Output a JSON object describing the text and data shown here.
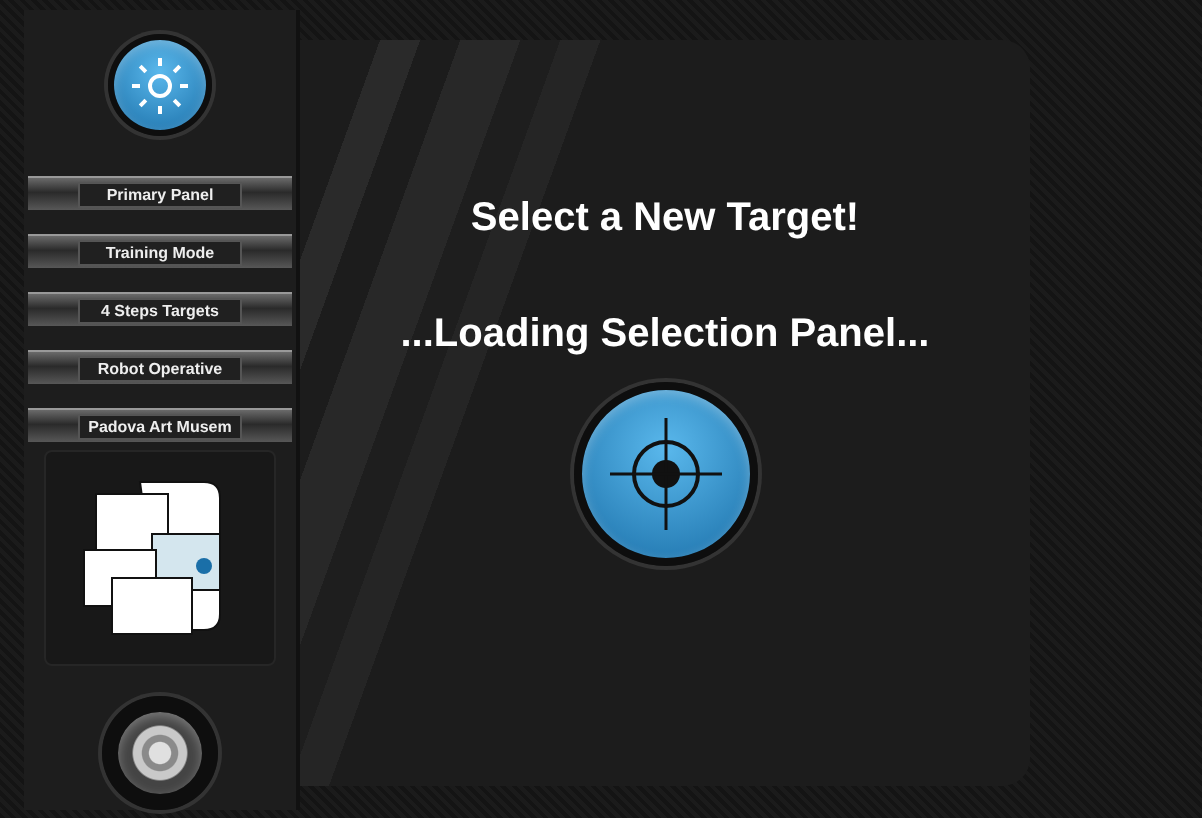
{
  "sidebar": {
    "menu": [
      {
        "label": "Primary Panel"
      },
      {
        "label": "Training Mode"
      },
      {
        "label": "4 Steps Targets"
      },
      {
        "label": "Robot Operative"
      },
      {
        "label": "Padova Art Musem"
      }
    ]
  },
  "main": {
    "title": "Select a New Target!",
    "status": "...Loading Selection Panel..."
  }
}
